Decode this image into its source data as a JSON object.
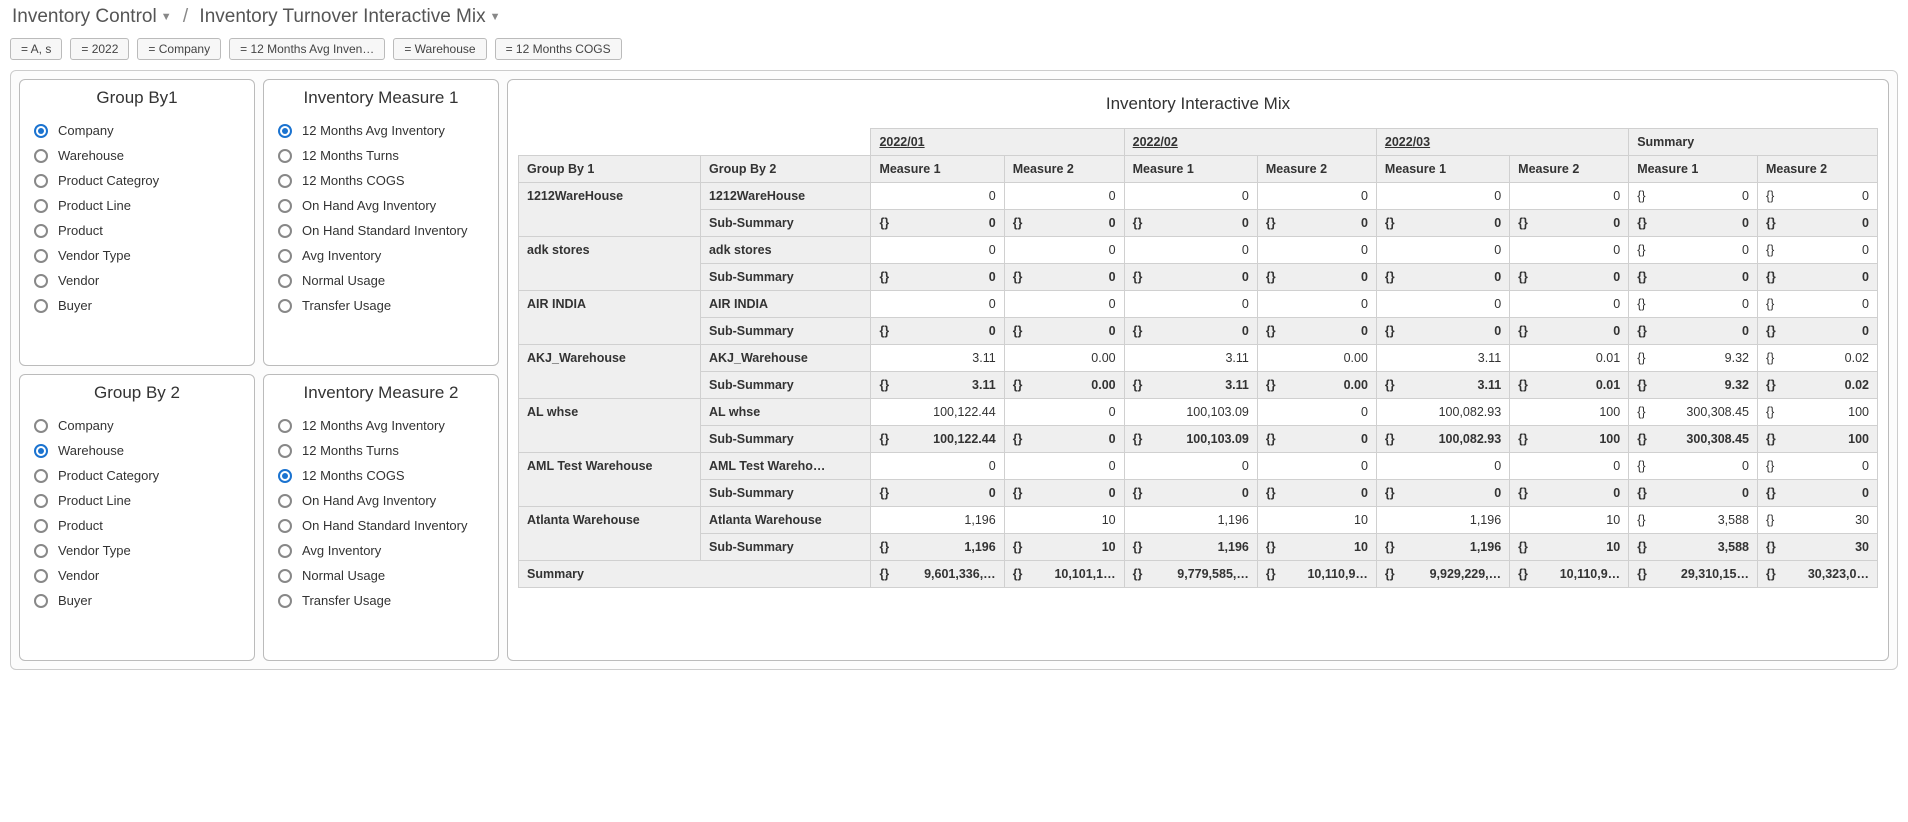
{
  "breadcrumb": {
    "root": "Inventory Control",
    "page": "Inventory Turnover Interactive Mix"
  },
  "filters": [
    "= A, s",
    "= 2022",
    "= Company",
    "= 12 Months Avg Inven…",
    "= Warehouse",
    "= 12 Months COGS"
  ],
  "panels": {
    "groupBy1": {
      "title": "Group By1",
      "items": [
        "Company",
        "Warehouse",
        "Product Categroy",
        "Product Line",
        "Product",
        "Vendor Type",
        "Vendor",
        "Buyer"
      ],
      "selected": 0
    },
    "groupBy2": {
      "title": "Group By 2",
      "items": [
        "Company",
        "Warehouse",
        "Product Category",
        "Product Line",
        "Product",
        "Vendor Type",
        "Vendor",
        "Buyer"
      ],
      "selected": 1
    },
    "measure1": {
      "title": "Inventory Measure 1",
      "items": [
        "12 Months Avg Inventory",
        "12 Months Turns",
        "12 Months COGS",
        "On Hand Avg Inventory",
        "On Hand Standard Inventory",
        "Avg Inventory",
        "Normal Usage",
        "Transfer Usage"
      ],
      "selected": 0
    },
    "measure2": {
      "title": "Inventory Measure 2",
      "items": [
        "12 Months Avg Inventory",
        "12 Months Turns",
        "12 Months COGS",
        "On Hand Avg Inventory",
        "On Hand Standard Inventory",
        "Avg Inventory",
        "Normal Usage",
        "Transfer Usage"
      ],
      "selected": 2
    }
  },
  "grid": {
    "title": "Inventory Interactive Mix",
    "periods": [
      "2022/01",
      "2022/02",
      "2022/03"
    ],
    "summaryLabel": "Summary",
    "headers": {
      "gb1": "Group By 1",
      "gb2": "Group By 2",
      "m1": "Measure 1",
      "m2": "Measure 2",
      "sub": "Sub-Summary",
      "grand": "Summary"
    },
    "brace": "{}",
    "rows": [
      {
        "gb1": "1212WareHouse",
        "gb2": "1212WareHouse",
        "data": {
          "p": [
            [
              "0",
              "0"
            ],
            [
              "0",
              "0"
            ],
            [
              "0",
              "0"
            ]
          ],
          "sum": [
            "0",
            "0"
          ]
        },
        "sub": {
          "p": [
            [
              "0",
              "0"
            ],
            [
              "0",
              "0"
            ],
            [
              "0",
              "0"
            ]
          ],
          "sum": [
            "0",
            "0"
          ]
        }
      },
      {
        "gb1": "adk stores",
        "gb2": "adk stores",
        "data": {
          "p": [
            [
              "0",
              "0"
            ],
            [
              "0",
              "0"
            ],
            [
              "0",
              "0"
            ]
          ],
          "sum": [
            "0",
            "0"
          ]
        },
        "sub": {
          "p": [
            [
              "0",
              "0"
            ],
            [
              "0",
              "0"
            ],
            [
              "0",
              "0"
            ]
          ],
          "sum": [
            "0",
            "0"
          ]
        }
      },
      {
        "gb1": "AIR INDIA",
        "gb2": "AIR INDIA",
        "data": {
          "p": [
            [
              "0",
              "0"
            ],
            [
              "0",
              "0"
            ],
            [
              "0",
              "0"
            ]
          ],
          "sum": [
            "0",
            "0"
          ]
        },
        "sub": {
          "p": [
            [
              "0",
              "0"
            ],
            [
              "0",
              "0"
            ],
            [
              "0",
              "0"
            ]
          ],
          "sum": [
            "0",
            "0"
          ]
        }
      },
      {
        "gb1": "AKJ_Warehouse",
        "gb2": "AKJ_Warehouse",
        "data": {
          "p": [
            [
              "3.11",
              "0.00"
            ],
            [
              "3.11",
              "0.00"
            ],
            [
              "3.11",
              "0.01"
            ]
          ],
          "sum": [
            "9.32",
            "0.02"
          ]
        },
        "sub": {
          "p": [
            [
              "3.11",
              "0.00"
            ],
            [
              "3.11",
              "0.00"
            ],
            [
              "3.11",
              "0.01"
            ]
          ],
          "sum": [
            "9.32",
            "0.02"
          ]
        }
      },
      {
        "gb1": "AL whse",
        "gb2": "AL whse",
        "data": {
          "p": [
            [
              "100,122.44",
              "0"
            ],
            [
              "100,103.09",
              "0"
            ],
            [
              "100,082.93",
              "100"
            ]
          ],
          "sum": [
            "300,308.45",
            "100"
          ]
        },
        "sub": {
          "p": [
            [
              "100,122.44",
              "0"
            ],
            [
              "100,103.09",
              "0"
            ],
            [
              "100,082.93",
              "100"
            ]
          ],
          "sum": [
            "300,308.45",
            "100"
          ]
        }
      },
      {
        "gb1": "AML Test Warehouse",
        "gb2": "AML Test Wareho…",
        "data": {
          "p": [
            [
              "0",
              "0"
            ],
            [
              "0",
              "0"
            ],
            [
              "0",
              "0"
            ]
          ],
          "sum": [
            "0",
            "0"
          ]
        },
        "sub": {
          "p": [
            [
              "0",
              "0"
            ],
            [
              "0",
              "0"
            ],
            [
              "0",
              "0"
            ]
          ],
          "sum": [
            "0",
            "0"
          ]
        }
      },
      {
        "gb1": "Atlanta Warehouse",
        "gb2": "Atlanta Warehouse",
        "data": {
          "p": [
            [
              "1,196",
              "10"
            ],
            [
              "1,196",
              "10"
            ],
            [
              "1,196",
              "10"
            ]
          ],
          "sum": [
            "3,588",
            "30"
          ]
        },
        "sub": {
          "p": [
            [
              "1,196",
              "10"
            ],
            [
              "1,196",
              "10"
            ],
            [
              "1,196",
              "10"
            ]
          ],
          "sum": [
            "3,588",
            "30"
          ]
        }
      }
    ],
    "grandSummary": {
      "p": [
        [
          "9,601,336,…",
          "10,101,1…"
        ],
        [
          "9,779,585,…",
          "10,110,9…"
        ],
        [
          "9,929,229,…",
          "10,110,9…"
        ]
      ],
      "sum": [
        "29,310,15…",
        "30,323,0…"
      ]
    }
  }
}
